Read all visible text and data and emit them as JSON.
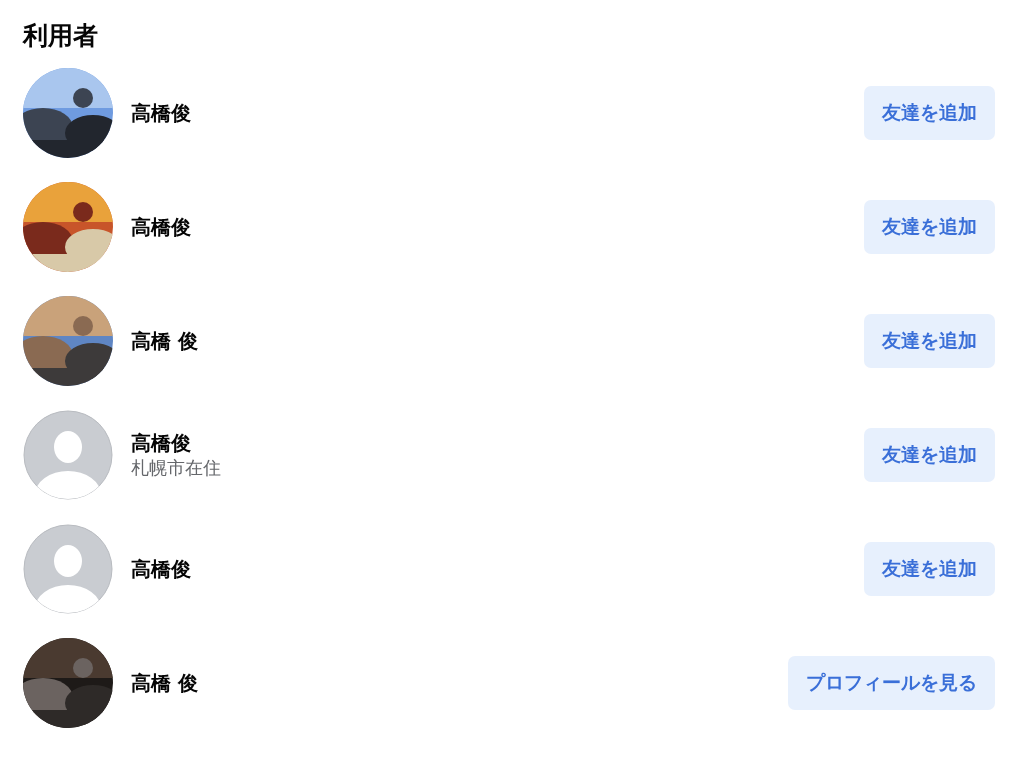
{
  "section": {
    "title": "利用者"
  },
  "users": [
    {
      "name": "高橋俊",
      "button": "友達を追加"
    },
    {
      "name": "高橋俊",
      "button": "友達を追加"
    },
    {
      "name": "高橋 俊",
      "button": "友達を追加"
    },
    {
      "name": "高橋俊",
      "subtitle": "札幌市在住",
      "avatar": {
        "kind": "default"
      },
      "button": "友達を追加"
    },
    {
      "name": "高橋俊",
      "avatar": {
        "kind": "default"
      },
      "button": "友達を追加"
    },
    {
      "name": "高橋 俊",
      "button": "プロフィールを見る"
    }
  ]
}
